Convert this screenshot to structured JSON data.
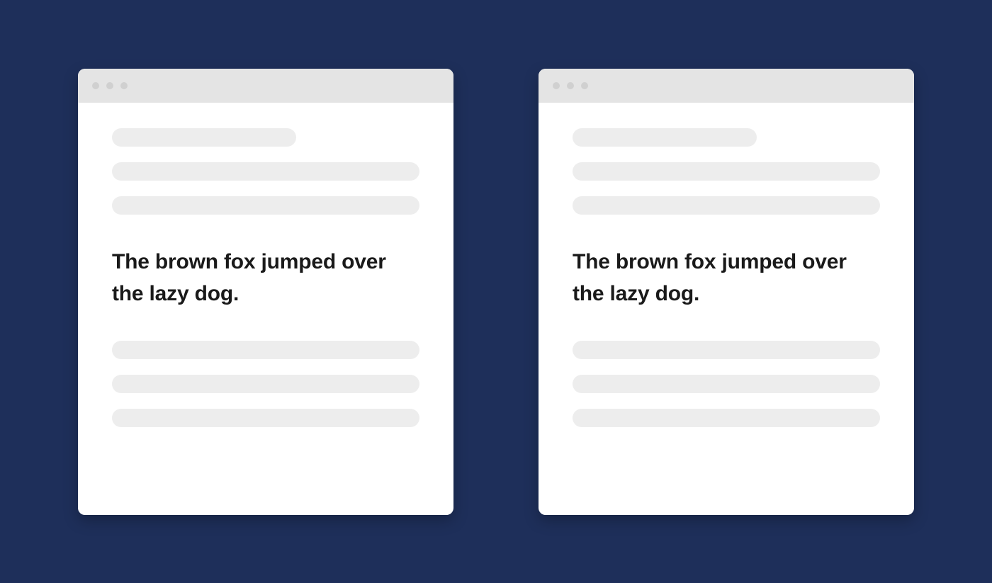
{
  "left": {
    "heading": "The brown fox jumped over the lazy dog."
  },
  "right": {
    "heading": "The brown fox jumped over the lazy dog."
  }
}
